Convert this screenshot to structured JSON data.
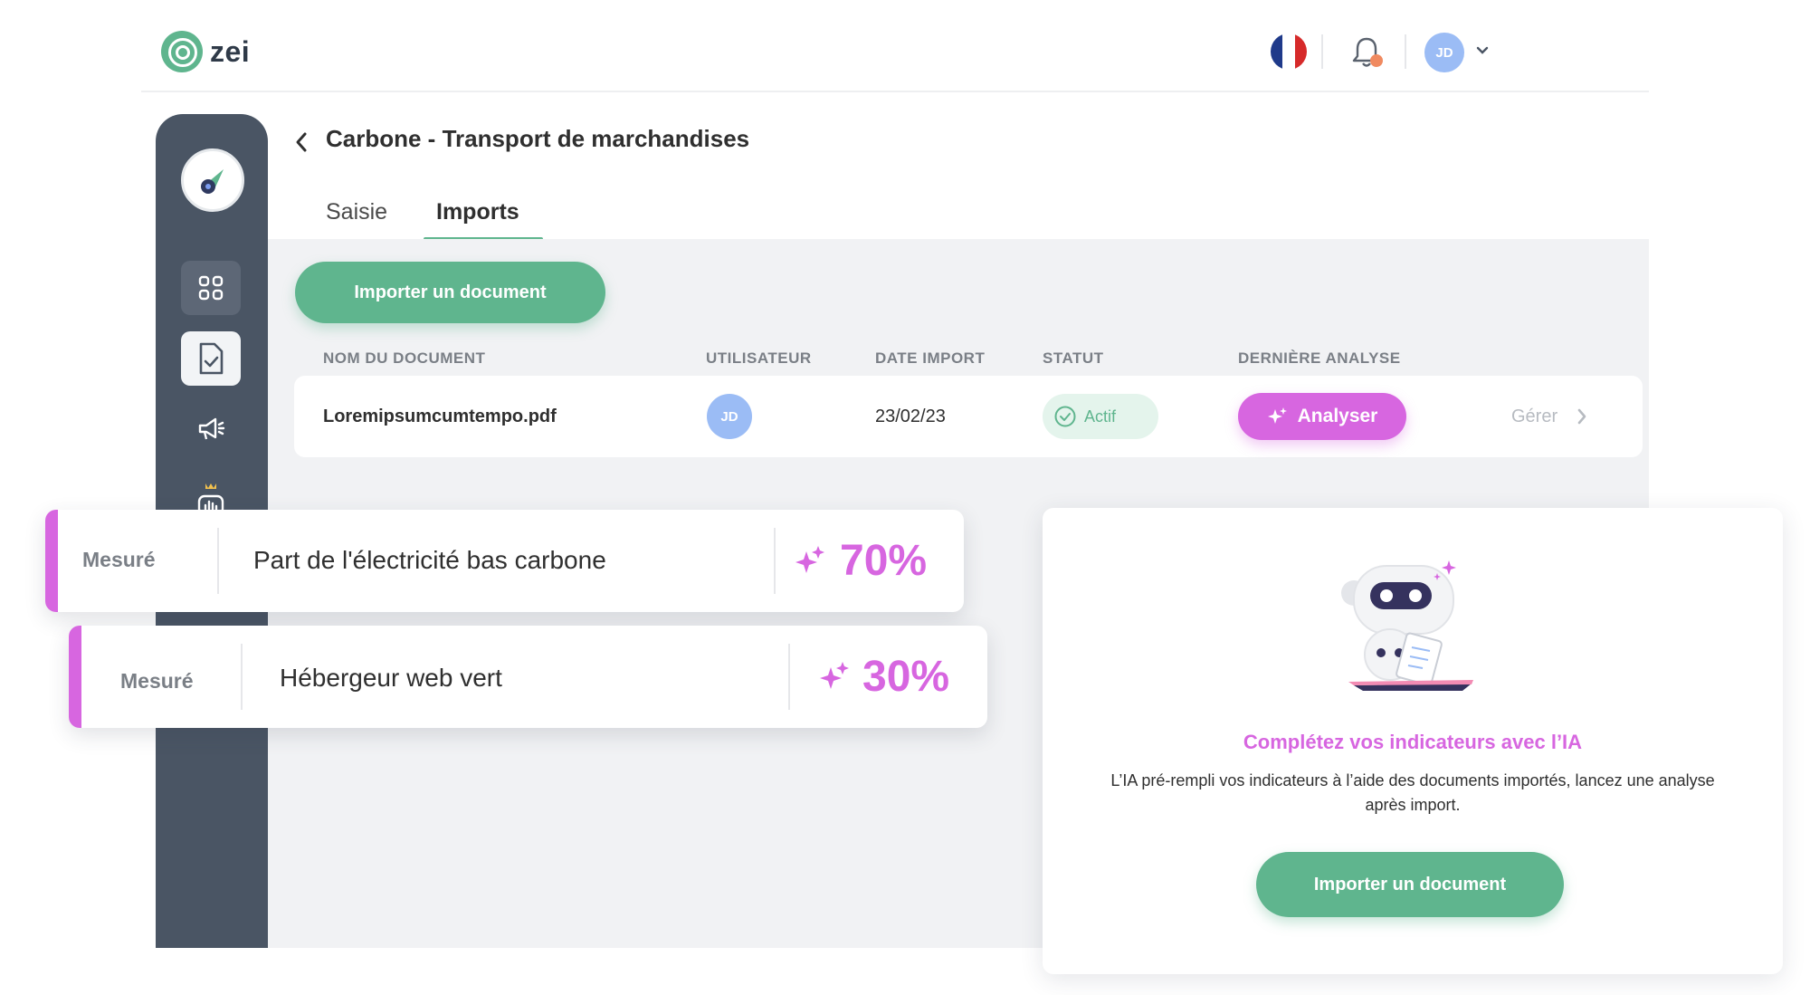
{
  "app": {
    "logo_text": "zei"
  },
  "topbar": {
    "user_initials": "JD",
    "flag_colors": [
      "#1f3a8a",
      "#ffffff",
      "#d62a2a"
    ],
    "notification_dot_color": "#f08a60"
  },
  "page": {
    "title": "Carbone - Transport de marchandises"
  },
  "tabs": [
    {
      "label": "Saisie",
      "active": false
    },
    {
      "label": "Imports",
      "active": true
    }
  ],
  "import_button": {
    "label": "Importer un document"
  },
  "table": {
    "headers": [
      "NOM DU DOCUMENT",
      "UTILISATEUR",
      "DATE IMPORT",
      "STATUT",
      "DERNIÈRE ANALYSE"
    ],
    "rows": [
      {
        "document": "Loremipsumcumtempo.pdf",
        "user_initials": "JD",
        "date": "23/02/23",
        "status": "Actif",
        "action": "Analyser",
        "manage": "Gérer"
      }
    ]
  },
  "metrics": [
    {
      "tag": "Mesuré",
      "name": "Part de l'électricité bas carbone",
      "value": "70%"
    },
    {
      "tag": "Mesuré",
      "name": "Hébergeur web vert",
      "value": "30%"
    }
  ],
  "ai_card": {
    "title": "Complétez vos indicateurs avec l’IA",
    "description": "L’IA pré-rempli vos indicateurs à l’aide des documents importés, lancez une analyse après import.",
    "button_label": "Importer un document"
  },
  "colors": {
    "primary_green": "#5fb58e",
    "accent_pink": "#d766e0",
    "sidebar": "#4a5564",
    "content_bg": "#f1f2f4"
  }
}
